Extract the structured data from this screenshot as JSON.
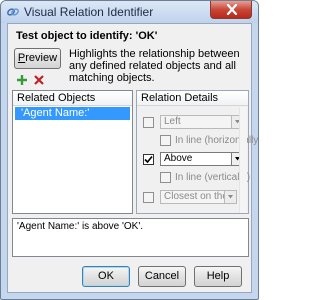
{
  "window": {
    "title": "Visual Relation Identifier",
    "app_icon": "link-chain-icon",
    "close_icon": "close-x-icon"
  },
  "heading": "Test object to identify: 'OK'",
  "preview": {
    "button_label": "Preview",
    "description": "Highlights the relationship between any defined related objects and all matching objects."
  },
  "toolbar": {
    "add_icon": "plus-icon",
    "add_color": "#3a9a3a",
    "remove_icon": "delete-x-icon",
    "remove_color": "#c0202a"
  },
  "related_objects": {
    "header": "Related Objects",
    "items": [
      "'Agent Name:'"
    ]
  },
  "relation_details": {
    "header": "Relation Details",
    "horizontal": {
      "checked": false,
      "value": "Left",
      "inline_label": "In line (horizontally)"
    },
    "vertical": {
      "checked": true,
      "value": "Above",
      "inline_label": "In line (vertically)"
    },
    "closest": {
      "checked": false,
      "value": "Closest on the X-axis"
    }
  },
  "result_text": "'Agent Name:' is above 'OK'.",
  "buttons": {
    "ok": "OK",
    "cancel": "Cancel",
    "help": "Help"
  },
  "colors": {
    "selection": "#3399ff",
    "frame": "#c5d7ee"
  }
}
